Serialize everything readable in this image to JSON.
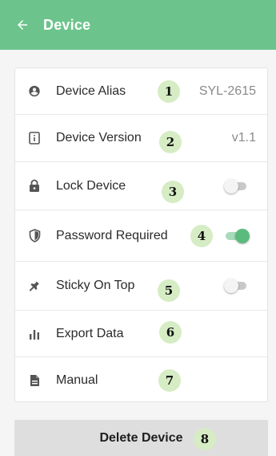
{
  "app_bar": {
    "back_icon": "arrow-left-icon",
    "title": "Device",
    "color": "#6cc48c"
  },
  "settings": [
    {
      "icon": "account-circle-icon",
      "label": "Device Alias",
      "value": "SYL-2615",
      "badge": "1"
    },
    {
      "icon": "info-box-icon",
      "label": "Device Version",
      "value": "v1.1",
      "badge": "2"
    },
    {
      "icon": "lock-icon",
      "label": "Lock Device",
      "toggle": "off",
      "badge": "3"
    },
    {
      "icon": "shield-icon",
      "label": "Password Required",
      "toggle": "on",
      "badge": "4"
    },
    {
      "icon": "pin-icon",
      "label": "Sticky On Top",
      "toggle": "off",
      "badge": "5"
    },
    {
      "icon": "bar-chart-icon",
      "label": "Export Data",
      "badge": "6"
    },
    {
      "icon": "file-document-icon",
      "label": "Manual",
      "badge": "7"
    }
  ],
  "delete_button": {
    "label": "Delete Device",
    "badge": "8"
  },
  "colors": {
    "accent": "#5bbb7d",
    "badge_bg": "#d6ecc4",
    "delete_bg": "#dedede"
  }
}
